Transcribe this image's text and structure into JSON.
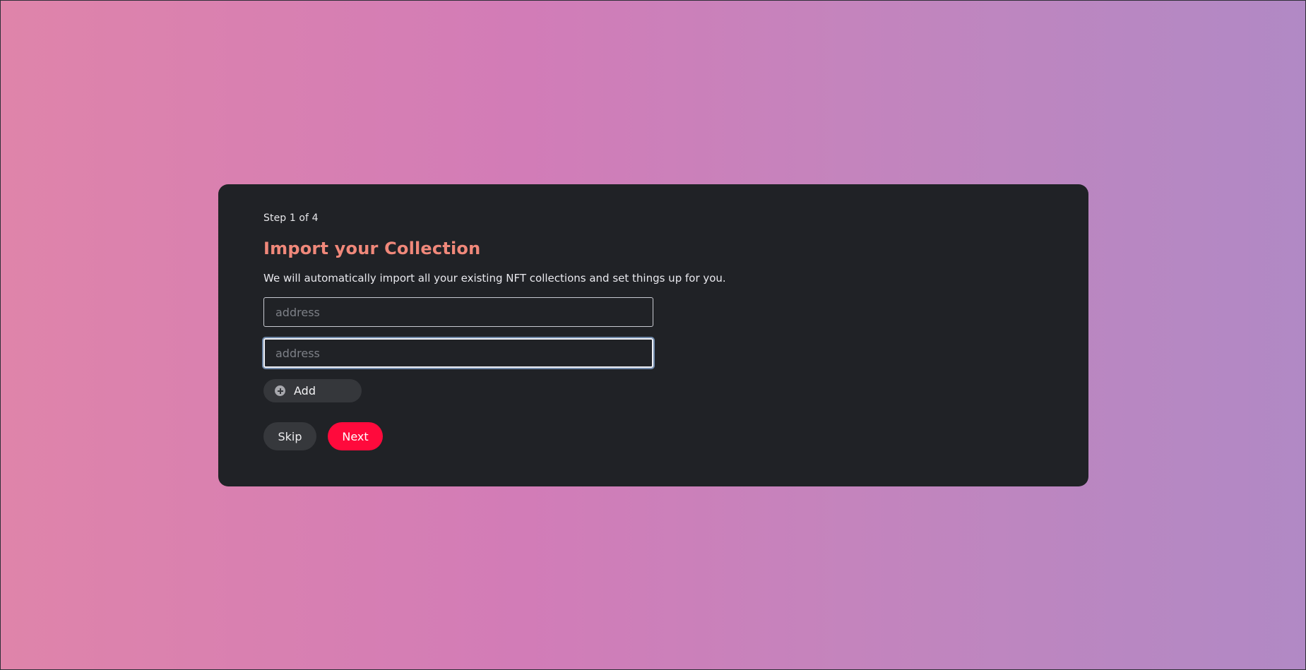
{
  "onboarding": {
    "step_label": "Step 1 of 4",
    "title": "Import your Collection",
    "description": "We will automatically import all your existing NFT collections and set things up for you.",
    "address_inputs": [
      {
        "value": "",
        "placeholder": "address"
      },
      {
        "value": "",
        "placeholder": "address"
      }
    ],
    "add_label": "Add",
    "add_icon": "plus-circle-icon",
    "skip_label": "Skip",
    "next_label": "Next"
  },
  "colors": {
    "title_accent": "#f0887a",
    "next_button": "#ff0a3c",
    "card_background": "#202226"
  }
}
